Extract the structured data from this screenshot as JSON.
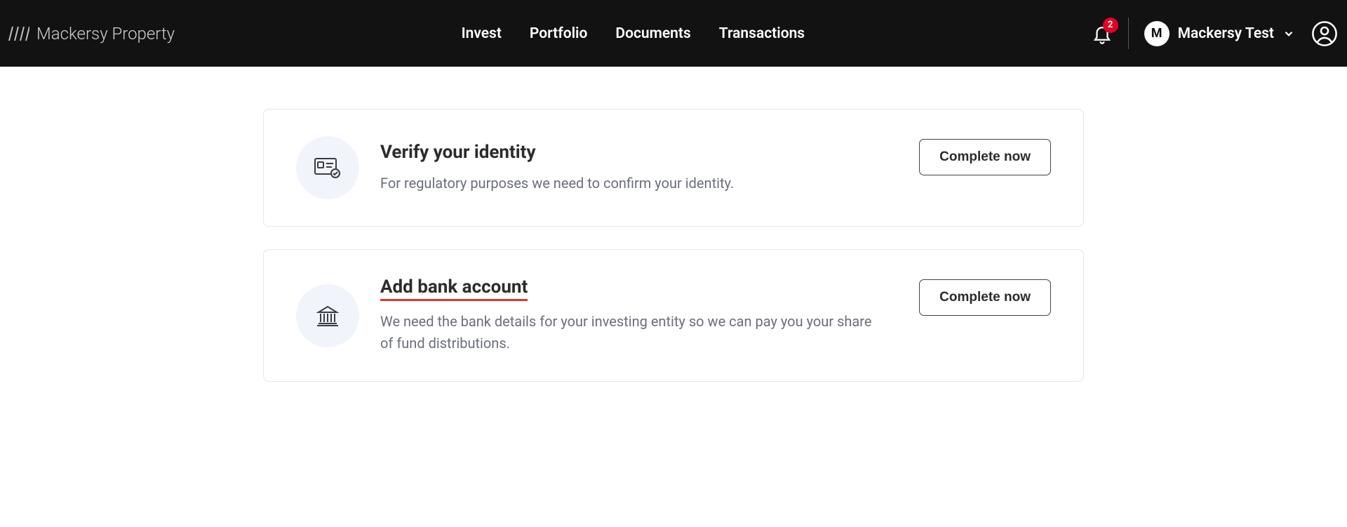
{
  "brand": {
    "name": "Mackersy Property"
  },
  "nav": {
    "items": [
      {
        "label": "Invest"
      },
      {
        "label": "Portfolio"
      },
      {
        "label": "Documents"
      },
      {
        "label": "Transactions"
      }
    ]
  },
  "notifications": {
    "count": "2"
  },
  "user": {
    "initial": "M",
    "name": "Mackersy Test"
  },
  "cards": {
    "verify": {
      "title": "Verify your identity",
      "desc": "For regulatory purposes we need to confirm your identity.",
      "action": "Complete now"
    },
    "bank": {
      "title": "Add bank account",
      "desc": "We need the bank details for your investing entity so we can pay you your share of fund distributions.",
      "action": "Complete now"
    }
  }
}
